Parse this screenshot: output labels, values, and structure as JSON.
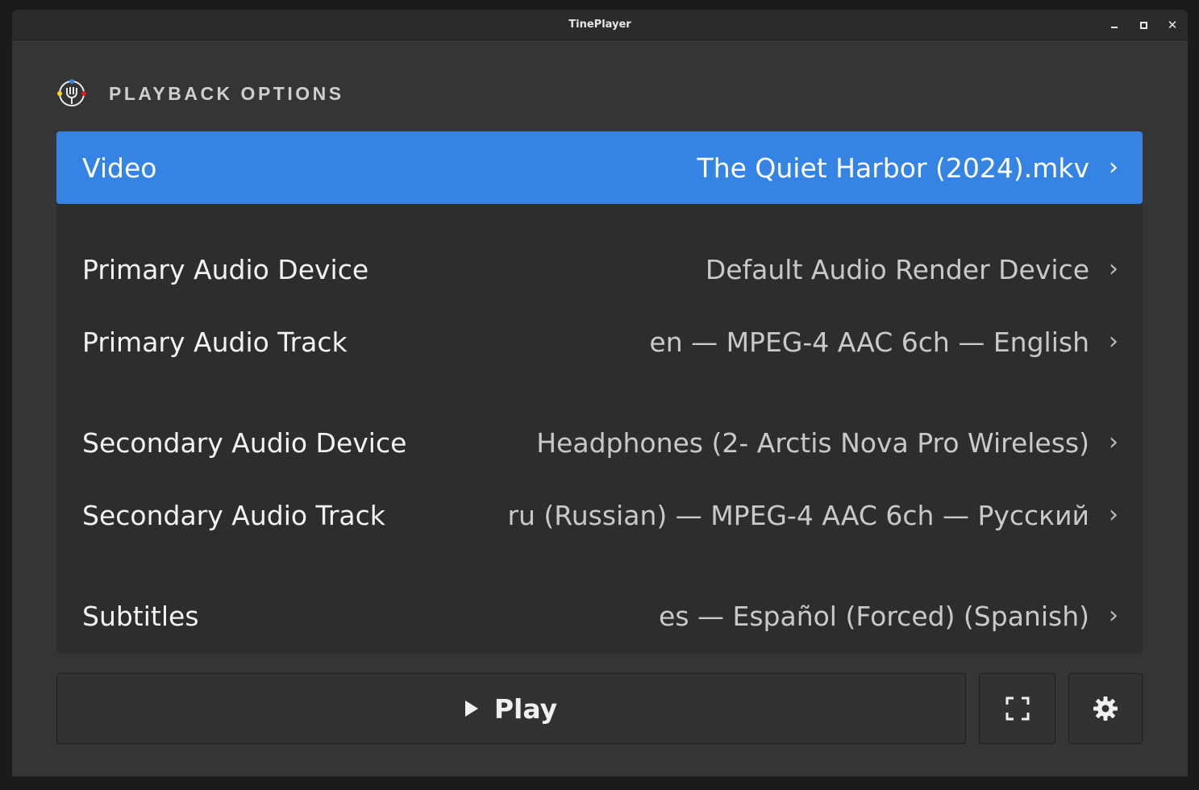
{
  "window": {
    "title": "TinePlayer"
  },
  "header": {
    "title": "PLAYBACK OPTIONS",
    "logo_icon": "tineplayer-logo-icon"
  },
  "options": [
    {
      "label": "Video",
      "value": "The Quiet Harbor (2024).mkv",
      "selected": true
    },
    {
      "label": "Primary Audio Device",
      "value": "Default Audio Render Device",
      "selected": false
    },
    {
      "label": "Primary Audio Track",
      "value": "en — MPEG-4 AAC 6ch — English",
      "selected": false
    },
    {
      "label": "Secondary Audio Device",
      "value": "Headphones (2- Arctis Nova Pro Wireless)",
      "selected": false
    },
    {
      "label": "Secondary Audio Track",
      "value": "ru (Russian) — MPEG-4 AAC 6ch — Русский",
      "selected": false
    },
    {
      "label": "Subtitles",
      "value": "es — Español (Forced) (Spanish)",
      "selected": false
    }
  ],
  "chevron_glyph": "›",
  "actions": {
    "play_label": "Play",
    "fullscreen_icon": "fullscreen-icon",
    "settings_icon": "gear-icon"
  },
  "colors": {
    "accent": "#3584e4",
    "window_bg": "#353535",
    "list_bg": "#2d2d2d"
  }
}
